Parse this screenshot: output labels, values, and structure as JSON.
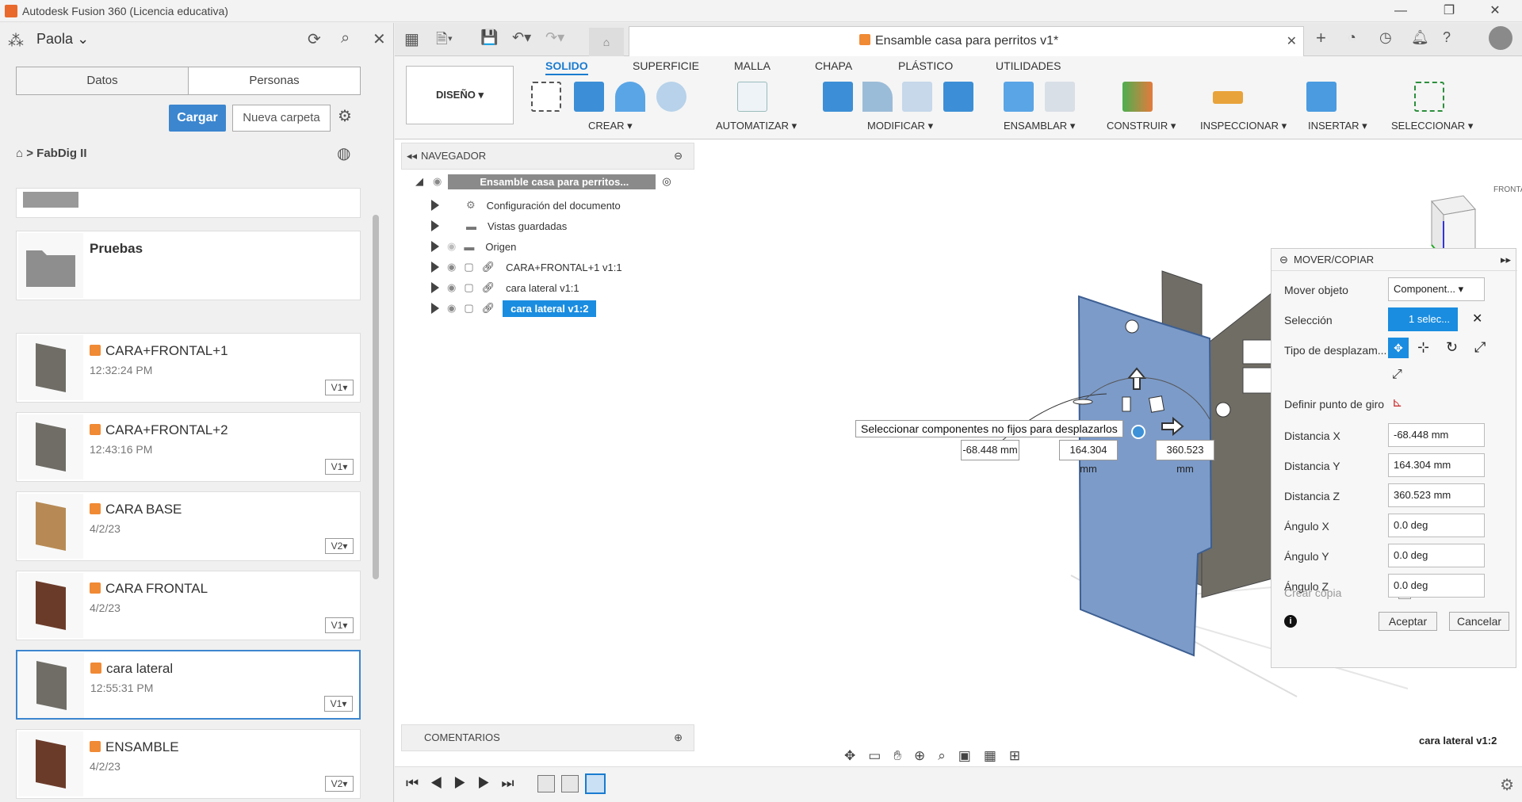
{
  "window": {
    "title": "Autodesk Fusion 360 (Licencia educativa)"
  },
  "data_panel": {
    "user": "Paola",
    "tabs": [
      "Datos",
      "Personas"
    ],
    "upload_button": "Cargar",
    "new_folder_button": "Nueva carpeta",
    "breadcrumb": "FabDig II",
    "folder_name": "Pruebas",
    "items": [
      {
        "name": "CARA+FRONTAL+1",
        "time": "12:32:24 PM",
        "version": "V1"
      },
      {
        "name": "CARA+FRONTAL+2",
        "time": "12:43:16 PM",
        "version": "V1"
      },
      {
        "name": "CARA BASE",
        "time": "4/2/23",
        "version": "V2"
      },
      {
        "name": "CARA FRONTAL",
        "time": "4/2/23",
        "version": "V1"
      },
      {
        "name": "cara lateral",
        "time": "12:55:31 PM",
        "version": "V1"
      },
      {
        "name": "ENSAMBLE",
        "time": "4/2/23",
        "version": "V2"
      }
    ]
  },
  "document": {
    "tab_title": "Ensamble casa para perritos v1*"
  },
  "ribbon": {
    "workspace": "DISEÑO",
    "tabs": [
      "SOLIDO",
      "SUPERFICIE",
      "MALLA",
      "CHAPA",
      "PLÁSTICO",
      "UTILIDADES"
    ],
    "groups": [
      "CREAR",
      "AUTOMATIZAR",
      "MODIFICAR",
      "ENSAMBLAR",
      "CONSTRUIR",
      "INSPECCIONAR",
      "INSERTAR",
      "SELECCIONAR"
    ]
  },
  "navigator": {
    "title": "NAVEGADOR",
    "root": "Ensamble casa para perritos...",
    "rows": [
      "Configuración del documento",
      "Vistas guardadas",
      "Origen",
      "CARA+FRONTAL+1 v1:1",
      "cara lateral v1:1",
      "cara lateral v1:2"
    ]
  },
  "comments": {
    "title": "COMENTARIOS"
  },
  "viewport": {
    "tooltip": "Seleccionar componentes no fijos para desplazarlos",
    "dims": [
      "-68.448 mm",
      "164.304 mm",
      "360.523 mm"
    ],
    "viewcube_label": "FRONTAL"
  },
  "move_panel": {
    "title": "MOVER/COPIAR",
    "move_object_label": "Mover objeto",
    "move_object_value": "Component...",
    "selection_label": "Selección",
    "selection_value": "1 selec...",
    "move_type_label": "Tipo de desplazam...",
    "pivot_label": "Definir punto de giro",
    "fields": [
      {
        "label": "Distancia X",
        "value": "-68.448 mm"
      },
      {
        "label": "Distancia Y",
        "value": "164.304 mm"
      },
      {
        "label": "Distancia Z",
        "value": "360.523 mm"
      },
      {
        "label": "Ángulo X",
        "value": "0.0 deg"
      },
      {
        "label": "Ángulo Y",
        "value": "0.0 deg"
      },
      {
        "label": "Ángulo Z",
        "value": "0.0 deg"
      }
    ],
    "create_copy_label": "Crear copia",
    "ok_button": "Aceptar",
    "cancel_button": "Cancelar"
  },
  "status": {
    "selection": "cara lateral v1:2"
  }
}
